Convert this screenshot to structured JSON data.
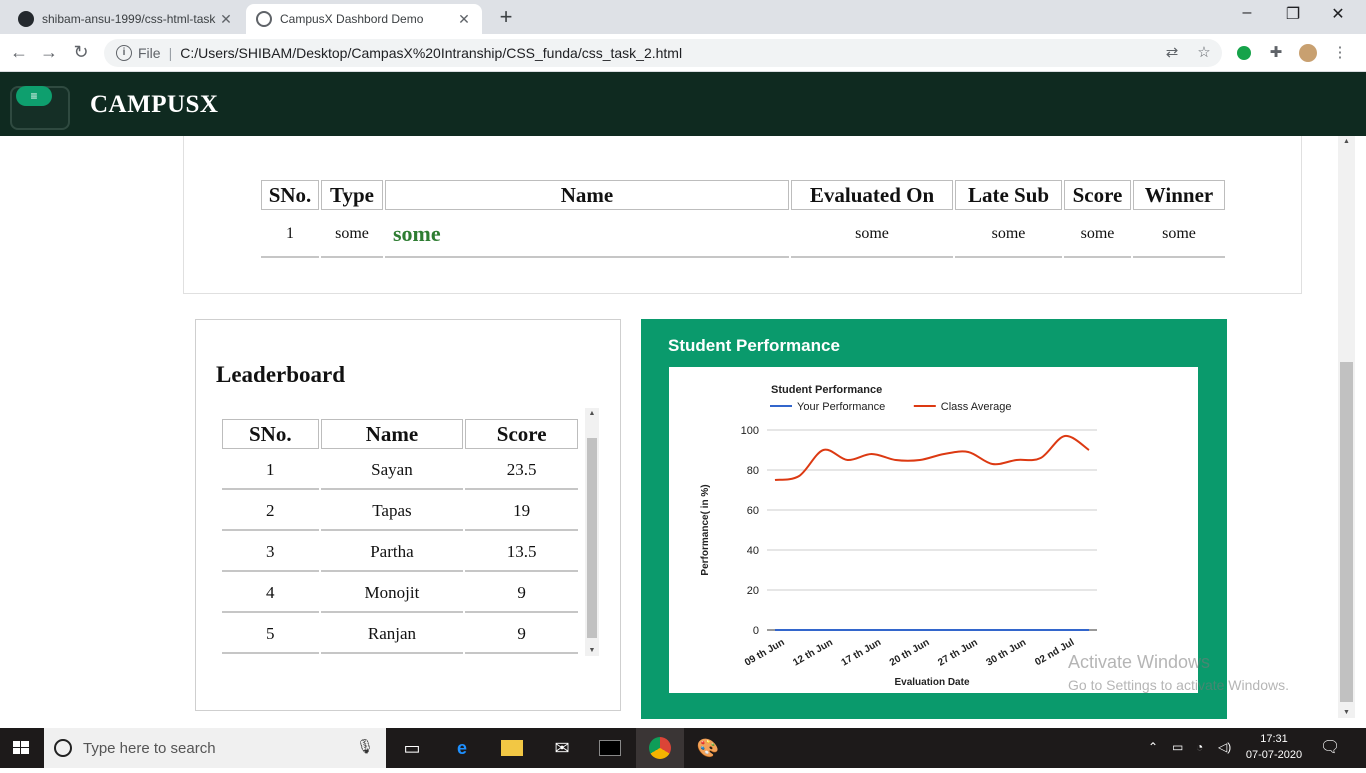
{
  "browser": {
    "tabs": [
      {
        "title": "shibam-ansu-1999/css-html-task",
        "active": false
      },
      {
        "title": "CampusX Dashbord Demo",
        "active": true
      }
    ],
    "file_label": "File",
    "url": "C:/Users/SHIBAM/Desktop/CampasX%20Intranship/CSS_funda/css_task_2.html"
  },
  "header": {
    "brand": "CAMPUSX",
    "menu_icon": "hamburger-icon"
  },
  "submissions": {
    "headers": [
      "SNo.",
      "Type",
      "Name",
      "Evaluated On",
      "Late Sub",
      "Score",
      "Winner"
    ],
    "rows": [
      {
        "sno": "1",
        "type": "some",
        "name": "some",
        "evaluated_on": "some",
        "late_sub": "some",
        "score": "some",
        "winner": "some"
      }
    ]
  },
  "leaderboard": {
    "title": "Leaderboard",
    "headers": [
      "SNo.",
      "Name",
      "Score"
    ],
    "rows": [
      {
        "sno": "1",
        "name": "Sayan",
        "score": "23.5"
      },
      {
        "sno": "2",
        "name": "Tapas",
        "score": "19"
      },
      {
        "sno": "3",
        "name": "Partha",
        "score": "13.5"
      },
      {
        "sno": "4",
        "name": "Monojit",
        "score": "9"
      },
      {
        "sno": "5",
        "name": "Ranjan",
        "score": "9"
      }
    ]
  },
  "performance": {
    "card_title": "Student Performance"
  },
  "chart_data": {
    "type": "line",
    "title": "Student Performance",
    "xlabel": "Evaluation Date",
    "ylabel": "Performance( in %)",
    "ylim": [
      0,
      100
    ],
    "yticks": [
      "0",
      "20",
      "40",
      "60",
      "80",
      "100"
    ],
    "categories": [
      "09 th Jun",
      "",
      "12 th Jun",
      "",
      "17 th Jun",
      "",
      "20 th Jun",
      "",
      "27 th Jun",
      "",
      "30 th Jun",
      "",
      "02 nd Jul",
      ""
    ],
    "legend_position": "top",
    "grid": true,
    "series": [
      {
        "name": "Your Performance",
        "color": "#3366cc",
        "values": [
          0,
          0,
          0,
          0,
          0,
          0,
          0,
          0,
          0,
          0,
          0,
          0,
          0,
          0
        ]
      },
      {
        "name": "Class Average",
        "color": "#dc3912",
        "values": [
          75,
          77,
          90,
          85,
          88,
          85,
          85,
          88,
          89,
          83,
          85,
          86,
          97,
          90
        ]
      }
    ]
  },
  "overlay": {
    "activate_title": "Activate Windows",
    "activate_sub": "Go to Settings to activate Windows."
  },
  "taskbar": {
    "search_placeholder": "Type here to search",
    "time": "17:31",
    "date": "07-07-2020"
  }
}
